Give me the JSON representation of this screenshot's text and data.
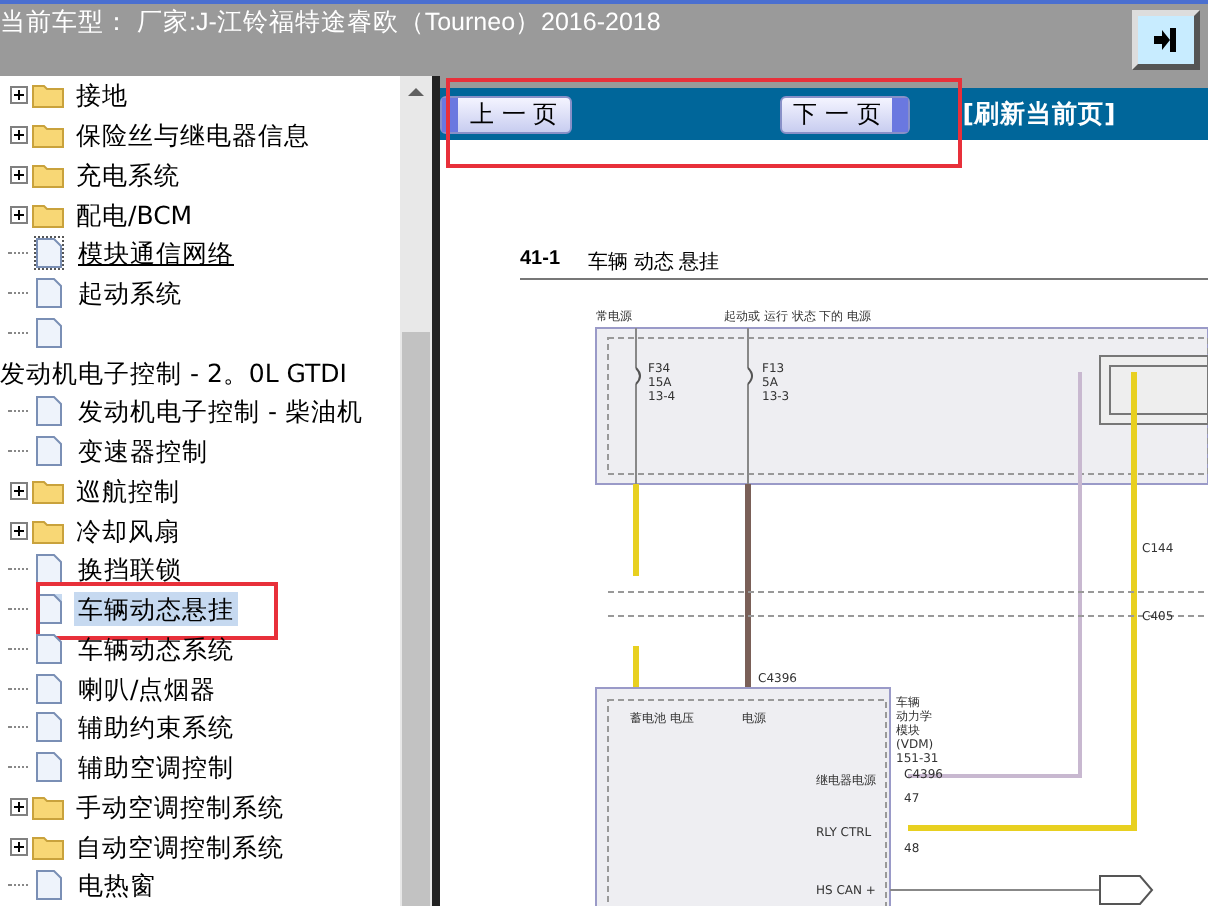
{
  "header": {
    "title": "当前车型： 厂家:J-江铃福特途睿欧（Tourneo）2016-2018"
  },
  "tree": {
    "items": [
      {
        "label": "接地",
        "kind": "folder",
        "expandable": true,
        "selected": false,
        "hovered": false,
        "highlighted": false
      },
      {
        "label": "保险丝与继电器信息",
        "kind": "folder",
        "expandable": true,
        "selected": false,
        "hovered": false,
        "highlighted": false
      },
      {
        "label": "充电系统",
        "kind": "folder",
        "expandable": true,
        "selected": false,
        "hovered": false,
        "highlighted": false
      },
      {
        "label": "配电/BCM",
        "kind": "folder",
        "expandable": true,
        "selected": false,
        "hovered": false,
        "highlighted": false
      },
      {
        "label": "模块通信网络",
        "kind": "doc",
        "expandable": false,
        "selected": false,
        "hovered": true,
        "highlighted": false
      },
      {
        "label": "起动系统",
        "kind": "doc",
        "expandable": false,
        "selected": false,
        "hovered": false,
        "highlighted": false
      },
      {
        "kind": "doc",
        "expandable": false,
        "selected": false,
        "hovered": false,
        "highlighted": false
      },
      {
        "label": "发动机电子控制 - 2。0L GTDI",
        "kind": "heading",
        "expandable": false,
        "selected": false,
        "hovered": false,
        "highlighted": false
      },
      {
        "label": "发动机电子控制 - 柴油机",
        "kind": "doc",
        "expandable": false,
        "selected": false,
        "hovered": false,
        "highlighted": false
      },
      {
        "label": "变速器控制",
        "kind": "doc",
        "expandable": false,
        "selected": false,
        "hovered": false,
        "highlighted": false
      },
      {
        "label": "巡航控制",
        "kind": "folder",
        "expandable": true,
        "selected": false,
        "hovered": false,
        "highlighted": false
      },
      {
        "label": "冷却风扇",
        "kind": "folder",
        "expandable": true,
        "selected": false,
        "hovered": false,
        "highlighted": false
      },
      {
        "label": "换挡联锁",
        "kind": "doc",
        "expandable": false,
        "selected": false,
        "hovered": false,
        "highlighted": false
      },
      {
        "label": "车辆动态悬挂",
        "kind": "doc",
        "expandable": false,
        "selected": true,
        "hovered": false,
        "highlighted": true
      },
      {
        "label": "车辆动态系统",
        "kind": "doc",
        "expandable": false,
        "selected": false,
        "hovered": false,
        "highlighted": false
      },
      {
        "label": "喇叭/点烟器",
        "kind": "doc",
        "expandable": false,
        "selected": false,
        "hovered": false,
        "highlighted": false
      },
      {
        "label": "辅助约束系统",
        "kind": "doc",
        "expandable": false,
        "selected": false,
        "hovered": false,
        "highlighted": false
      },
      {
        "label": "辅助空调控制",
        "kind": "doc",
        "expandable": false,
        "selected": false,
        "hovered": false,
        "highlighted": false
      },
      {
        "label": "手动空调控制系统",
        "kind": "folder",
        "expandable": true,
        "selected": false,
        "hovered": false,
        "highlighted": false
      },
      {
        "label": "自动空调控制系统",
        "kind": "folder",
        "expandable": true,
        "selected": false,
        "hovered": false,
        "highlighted": false
      },
      {
        "label": "电热窗",
        "kind": "doc",
        "expandable": false,
        "selected": false,
        "hovered": false,
        "highlighted": false
      }
    ]
  },
  "nav": {
    "highlighted": true,
    "prev": "上 一 页",
    "next": "下 一 页",
    "refresh": "[刷新当前页]"
  },
  "document": {
    "number": "41-1",
    "title": "车辆 动态 悬挂",
    "labels": [
      "常电源",
      "起动或 运行 状态 下的 电源",
      "F34",
      "15A",
      "13-4",
      "F13",
      "5A",
      "13-3",
      "C144",
      "C405",
      "C4396",
      "蓄电池 电压",
      "电源",
      "车辆",
      "动力学",
      "模块",
      "(VDM)",
      "151-31",
      "C4396",
      "继电器电源",
      "47",
      "RLY CTRL",
      "48",
      "HS CAN +"
    ]
  }
}
